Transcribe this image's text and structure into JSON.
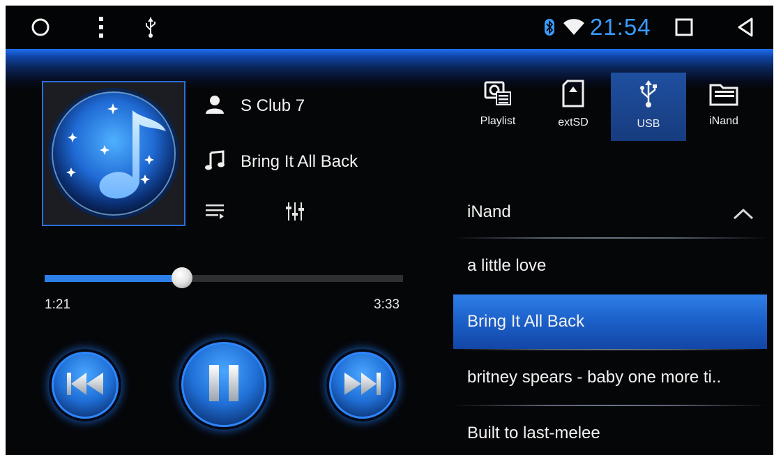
{
  "statusbar": {
    "icons": [
      "circle-home-icon",
      "more-vertical-icon",
      "usb-icon",
      "bluetooth-icon",
      "wifi-icon",
      "square-recents-icon",
      "triangle-back-icon"
    ],
    "time": "21:54"
  },
  "now_playing": {
    "artist": "S Club 7",
    "title": "Bring It All Back",
    "elapsed": "1:21",
    "duration": "3:33",
    "progress_fraction": 0.384
  },
  "sources": [
    {
      "label": "Playlist",
      "icon": "playlist-icon"
    },
    {
      "label": "extSD",
      "icon": "sd-card-icon"
    },
    {
      "label": "USB",
      "icon": "usb-icon",
      "active": true
    },
    {
      "label": "iNand",
      "icon": "folder-icon"
    }
  ],
  "list": {
    "header": "iNand",
    "items": [
      {
        "label": "a little love"
      },
      {
        "label": "Bring It All Back",
        "selected": true
      },
      {
        "label": "britney spears - baby one more ti.."
      },
      {
        "label": "Built to last-melee"
      }
    ]
  },
  "colors": {
    "accent": "#2d7fe8",
    "clock": "#3a9cff",
    "background": "#050608"
  }
}
